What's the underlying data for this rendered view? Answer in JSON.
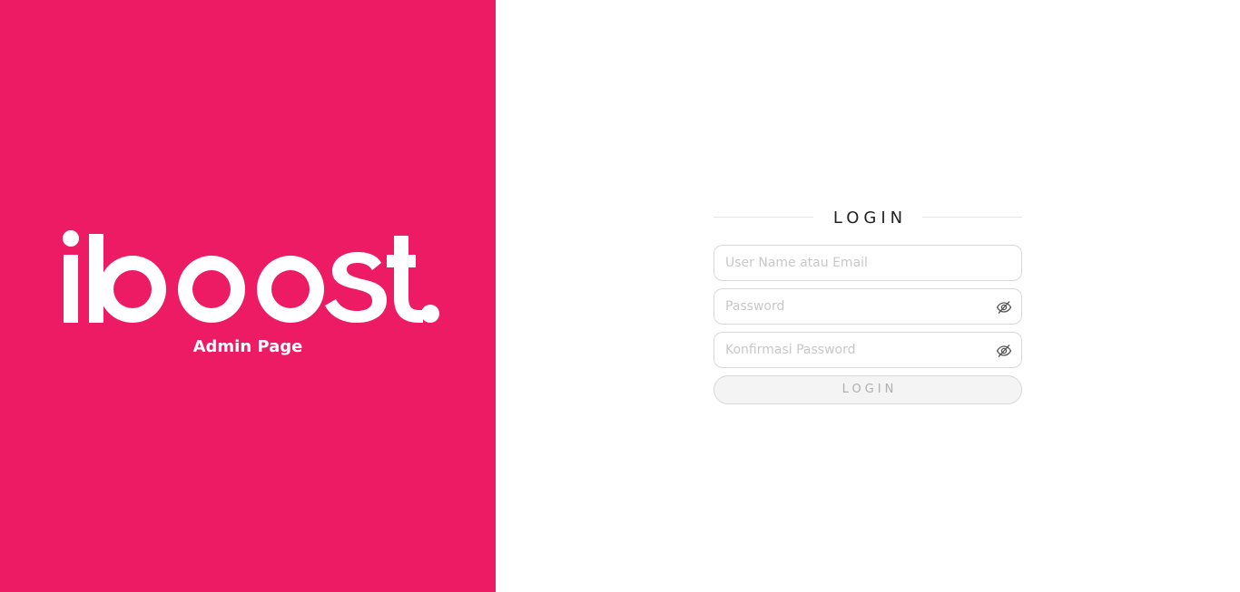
{
  "brand": {
    "logo_text": "iboost.",
    "subtitle": "Admin Page",
    "background_color": "#ec1b64"
  },
  "login": {
    "heading": "LOGIN",
    "username": {
      "placeholder": "User Name atau Email",
      "value": ""
    },
    "password": {
      "placeholder": "Password",
      "value": "",
      "toggle_icon": "eye-slash-icon"
    },
    "confirm_password": {
      "placeholder": "Konfirmasi Password",
      "value": "",
      "toggle_icon": "eye-slash-icon"
    },
    "submit_label": "LOGIN"
  }
}
